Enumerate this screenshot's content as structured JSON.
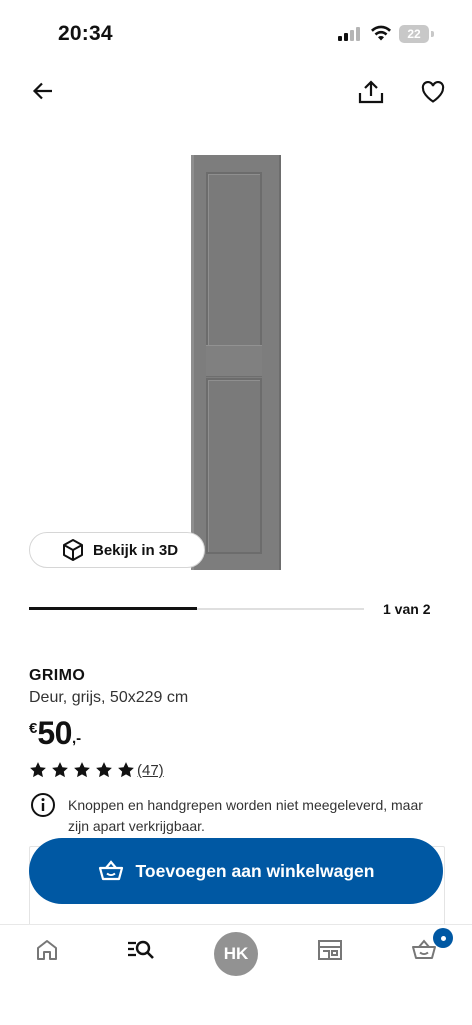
{
  "status_bar": {
    "time": "20:34",
    "battery": "22"
  },
  "nav": {
    "back_icon": "arrow-left-icon",
    "share_icon": "share-icon",
    "favorite_icon": "heart-icon"
  },
  "gallery": {
    "view_3d_label": "Bekijk in 3D",
    "pager": "1 van 2",
    "progress": 0.5
  },
  "product": {
    "name": "GRIMO",
    "description": "Deur, grijs, 50x229 cm",
    "price_currency": "€",
    "price_integer": "50",
    "price_decimal": ",-",
    "rating_stars": 5,
    "reviews": "(47)",
    "notice": "Knoppen en handgrepen worden niet meegeleverd, maar zijn apart verkrijgbaar."
  },
  "cta": {
    "add_to_cart": "Toevoegen aan winkelwagen"
  },
  "tabbar": {
    "profile_initials": "HK"
  },
  "colors": {
    "brand_blue": "#0058a3",
    "door_gray": "#7d7d7d"
  }
}
